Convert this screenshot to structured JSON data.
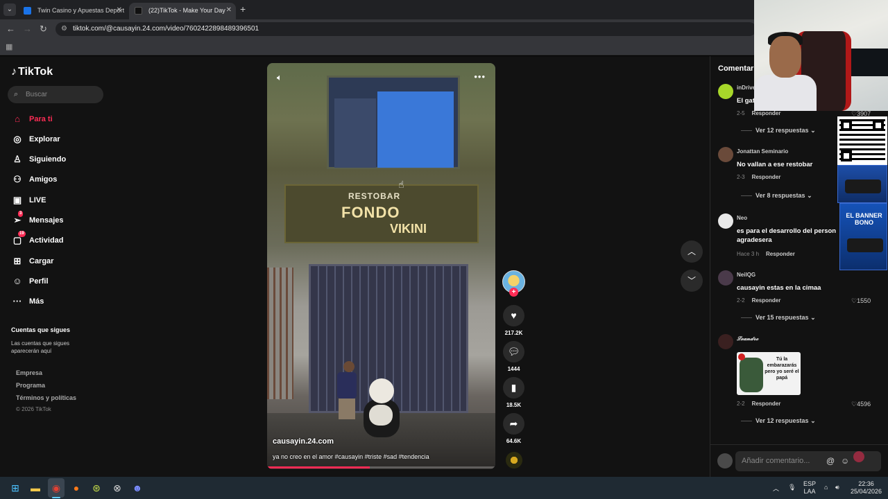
{
  "browser": {
    "tabs": [
      {
        "title": "Twin Casino y Apuestas Deport",
        "favicon_color": "#1a73e8"
      },
      {
        "title": "(22)TikTok - Make Your Day",
        "favicon_color": "#111111"
      }
    ],
    "url": "tiktok.com/@causayin.24.com/video/7602422898489396501"
  },
  "sidebar": {
    "logo": "TikTok",
    "search_placeholder": "Buscar",
    "menu": [
      {
        "label": "Para ti",
        "icon": "home-icon",
        "active": true
      },
      {
        "label": "Explorar",
        "icon": "compass-icon"
      },
      {
        "label": "Siguiendo",
        "icon": "following-icon"
      },
      {
        "label": "Amigos",
        "icon": "friends-icon"
      },
      {
        "label": "LIVE",
        "icon": "live-icon"
      },
      {
        "label": "Mensajes",
        "icon": "messages-icon",
        "badge": "3"
      },
      {
        "label": "Actividad",
        "icon": "activity-icon",
        "badge": "19"
      },
      {
        "label": "Cargar",
        "icon": "upload-icon"
      },
      {
        "label": "Perfil",
        "icon": "profile-icon"
      },
      {
        "label": "Más",
        "icon": "more-icon"
      }
    ],
    "following_title": "Cuentas que sigues",
    "following_desc": "Las cuentas que sigues aparecerán aquí",
    "footer": [
      "Empresa",
      "Programa",
      "Términos y políticas"
    ],
    "copyright": "© 2026 TikTok"
  },
  "video": {
    "sign_line1": "RESTOBAR",
    "sign_line2": "FONDO",
    "sign_line3": "VIKINI",
    "username": "causayin.24.com",
    "caption": "ya no creo en el amor #causayin #triste #sad #tendencia",
    "progress": 0.45
  },
  "actions": {
    "likes": "217.2K",
    "comments": "1444",
    "saves": "18.5K",
    "shares": "64.6K"
  },
  "comments": {
    "title": "Comentar",
    "items": [
      {
        "name": "inDrive",
        "text": "El gat",
        "meta": "2-5",
        "reply": "Responder",
        "likes": "3907",
        "replies": "Ver 12 respuestas",
        "avatar_color": "#a8d82a"
      },
      {
        "name": "Jonattan Seminario",
        "text": "No vallan a ese restobar",
        "meta": "2-3",
        "reply": "Responder",
        "replies": "Ver 8 respuestas",
        "avatar_color": "#6a4a3a"
      },
      {
        "name": "Neo",
        "text": "es para el desarrollo del person agradesera",
        "meta": "Hace 3 h",
        "reply": "Responder",
        "avatar_color": "#e8e8e8"
      },
      {
        "name": "NeilQG",
        "text": "causayin estas en la cimaa",
        "meta": "2-2",
        "reply": "Responder",
        "likes": "1550",
        "replies": "Ver 15 respuestas",
        "avatar_color": "#4a3a4a"
      },
      {
        "name": "𝓛𝓮𝓪𝓷𝓭𝓻𝓸",
        "sticker_text": "Tú la embarazarás pero yo seré el papá",
        "meta": "2-2",
        "reply": "Responder",
        "likes": "4596",
        "replies": "Ver 12 respuestas",
        "avatar_color": "#3a2020"
      }
    ],
    "input_placeholder": "Añadir comentario..."
  },
  "overlay": {
    "ad_title": "EL BANNER BONO"
  },
  "taskbar": {
    "lang1": "ESP",
    "lang2": "LAA",
    "time": "22:36",
    "date": "25/04/2026"
  }
}
